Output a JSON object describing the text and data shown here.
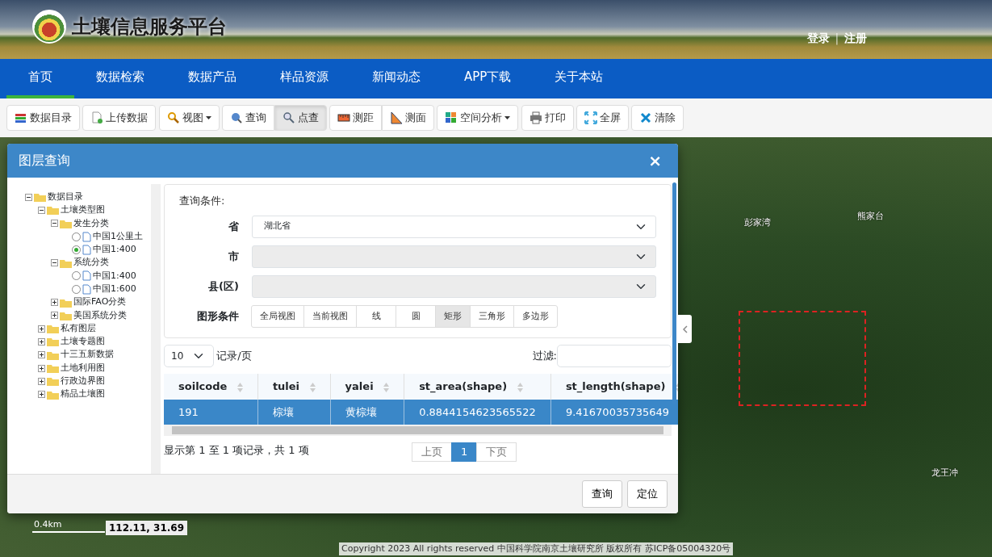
{
  "header": {
    "title": "土壤信息服务平台",
    "login": "登录",
    "separator": "|",
    "register": "注册"
  },
  "nav": [
    {
      "label": "首页",
      "selected": true
    },
    {
      "label": "数据检索",
      "selected": false
    },
    {
      "label": "数据产品",
      "selected": false
    },
    {
      "label": "样品资源",
      "selected": false
    },
    {
      "label": "新闻动态",
      "selected": false
    },
    {
      "label": "APP下载",
      "selected": false
    },
    {
      "label": "关于本站",
      "selected": false
    }
  ],
  "toolbar": [
    [
      {
        "label": "数据目录",
        "dropdown": false,
        "selected": false
      }
    ],
    [
      {
        "label": "上传数据",
        "dropdown": false,
        "selected": false
      }
    ],
    [
      {
        "label": "视图",
        "dropdown": true,
        "selected": false
      }
    ],
    [
      {
        "label": "查询",
        "dropdown": false,
        "selected": false
      },
      {
        "label": "点查",
        "dropdown": false,
        "selected": true
      }
    ],
    [
      {
        "label": "测距",
        "dropdown": false,
        "selected": false
      },
      {
        "label": "测面",
        "dropdown": false,
        "selected": false
      }
    ],
    [
      {
        "label": "空间分析",
        "dropdown": true,
        "selected": false
      }
    ],
    [
      {
        "label": "打印",
        "dropdown": false,
        "selected": false
      }
    ],
    [
      {
        "label": "全屏",
        "dropdown": false,
        "selected": false
      }
    ],
    [
      {
        "label": "清除",
        "dropdown": false,
        "selected": false
      }
    ]
  ],
  "map": {
    "labels": [
      {
        "text": "彭家湾"
      },
      {
        "text": "熊家台"
      },
      {
        "text": "龙王冲"
      }
    ],
    "scale": "0.4km",
    "coordinates": "112.11, 31.69",
    "copyright": "Copyright 2023 All rights reserved 中国科学院南京土壤研究所 版权所有 苏ICP备05004320号"
  },
  "dialog": {
    "title": "图层查询",
    "close": "×",
    "tree": [
      {
        "kind": "folder",
        "label": "数据目录",
        "expanded": true,
        "children": [
          {
            "kind": "folder",
            "label": "土壤类型图",
            "expanded": true,
            "children": [
              {
                "kind": "folder",
                "label": "发生分类",
                "expanded": true,
                "children": [
                  {
                    "kind": "layer",
                    "label": "中国1公里土",
                    "selected": false
                  },
                  {
                    "kind": "layer",
                    "label": "中国1:400",
                    "selected": true
                  }
                ]
              },
              {
                "kind": "folder",
                "label": "系统分类",
                "expanded": true,
                "children": [
                  {
                    "kind": "layer",
                    "label": "中国1:400",
                    "selected": false
                  },
                  {
                    "kind": "layer",
                    "label": "中国1:600",
                    "selected": false
                  }
                ]
              },
              {
                "kind": "folder",
                "label": "国际FAO分类",
                "expanded": false
              },
              {
                "kind": "folder",
                "label": "美国系统分类",
                "expanded": false
              }
            ]
          },
          {
            "kind": "folder",
            "label": "私有图层",
            "expanded": false
          },
          {
            "kind": "folder",
            "label": "土壤专题图",
            "expanded": false
          },
          {
            "kind": "folder",
            "label": "十三五新数据",
            "expanded": false
          },
          {
            "kind": "folder",
            "label": "土地利用图",
            "expanded": false
          },
          {
            "kind": "folder",
            "label": "行政边界图",
            "expanded": false
          },
          {
            "kind": "folder",
            "label": "精品土壤图",
            "expanded": false
          }
        ]
      }
    ],
    "conditions_title": "查询条件:",
    "fields": [
      {
        "label": "省",
        "value": "湖北省",
        "disabled": false
      },
      {
        "label": "市",
        "disabled": true
      },
      {
        "label": "县(区)",
        "disabled": true
      }
    ],
    "shape_label": "图形条件",
    "shapes": [
      {
        "label": "全局视图",
        "selected": false
      },
      {
        "label": "当前视图",
        "selected": false
      },
      {
        "label": "线",
        "selected": false
      },
      {
        "label": "圆",
        "selected": false
      },
      {
        "label": "矩形",
        "selected": true
      },
      {
        "label": "三角形",
        "selected": false
      },
      {
        "label": "多边形",
        "selected": false
      }
    ],
    "page_size": "10",
    "page_size_label": "记录/页",
    "filter_label": "过滤:",
    "table": {
      "columns": [
        "soilcode",
        "tulei",
        "yalei",
        "st_area(shape)",
        "st_length(shape)"
      ],
      "rows": [
        {
          "cells": [
            "191",
            "棕壤",
            "黄棕壤",
            "0.8844154623565522",
            "9.41670035735649"
          ],
          "selected": true
        }
      ]
    },
    "info": "显示第 1 至 1 项记录，共 1 项",
    "pagination": [
      {
        "label": "上页",
        "selected": false
      },
      {
        "label": "1",
        "selected": true
      },
      {
        "label": "下页",
        "selected": false
      }
    ],
    "buttons": [
      "查询",
      "定位"
    ]
  }
}
